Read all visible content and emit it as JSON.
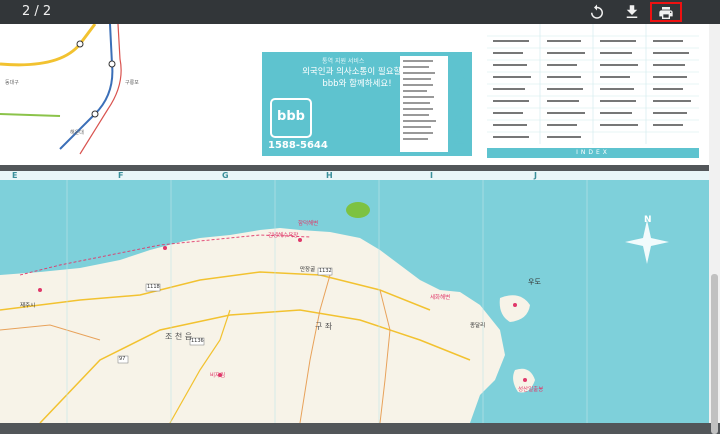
{
  "toolbar": {
    "page_indicator": "2 / 2",
    "rotate_icon": "rotate-icon",
    "download_icon": "download-icon",
    "print_icon": "print-icon"
  },
  "page1": {
    "interpreter_tag": "통역 지원 서비스",
    "interpreter_text": "외국인과 의사소통이 필요할 때 bbb와 함께하세요!",
    "bbb_logo": "bbb",
    "phone_small": "1588-5644",
    "phone_big": "1588-5644",
    "index_label": "INDEX"
  },
  "page2": {
    "grid_columns": [
      "E",
      "F",
      "G",
      "H",
      "I",
      "J"
    ],
    "places": [
      {
        "name": "함덕해변",
        "pink": true
      },
      {
        "name": "김녕해수욕장",
        "pink": true
      },
      {
        "name": "만장굴",
        "pink": false
      },
      {
        "name": "구 좌",
        "pink": false
      },
      {
        "name": "조 천 읍",
        "pink": false
      },
      {
        "name": "세화해변",
        "pink": true
      },
      {
        "name": "우도",
        "pink": false
      },
      {
        "name": "성산일출봉",
        "pink": true
      },
      {
        "name": "종달리",
        "pink": false
      },
      {
        "name": "1132",
        "pink": false
      },
      {
        "name": "1118",
        "pink": false
      },
      {
        "name": "1136",
        "pink": false
      },
      {
        "name": "97",
        "pink": false
      },
      {
        "name": "비자림",
        "pink": true
      },
      {
        "name": "제주시",
        "pink": false
      }
    ],
    "compass_label": "N"
  },
  "colors": {
    "toolbar_bg": "#323639",
    "sea": "#7ed0da",
    "land": "#f7f3e8",
    "accent": "#5ec3cf",
    "highlight": "#e11111"
  }
}
